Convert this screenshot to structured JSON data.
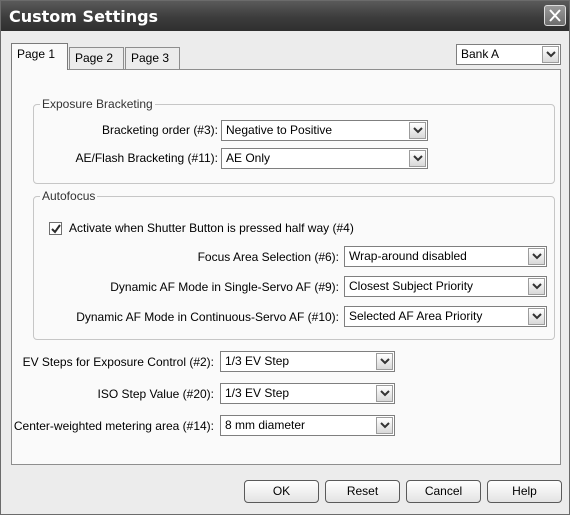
{
  "window": {
    "title": "Custom Settings"
  },
  "tabs": [
    {
      "label": "Page 1",
      "active": true
    },
    {
      "label": "Page 2",
      "active": false
    },
    {
      "label": "Page 3",
      "active": false
    }
  ],
  "bank_select": {
    "value": "Bank A"
  },
  "exposure_bracketing": {
    "legend": "Exposure Bracketing",
    "order_label": "Bracketing order (#3):",
    "order_value": "Negative to Positive",
    "ae_flash_label": "AE/Flash Bracketing (#11):",
    "ae_flash_value": "AE Only"
  },
  "autofocus": {
    "legend": "Autofocus",
    "activate_label": "Activate when Shutter Button is pressed half way (#4)",
    "activate_checked": true,
    "focus_area_label": "Focus Area Selection (#6):",
    "focus_area_value": "Wrap-around disabled",
    "single_servo_label": "Dynamic AF Mode in Single-Servo AF (#9):",
    "single_servo_value": "Closest Subject Priority",
    "continuous_servo_label": "Dynamic AF Mode in Continuous-Servo AF (#10):",
    "continuous_servo_value": "Selected AF Area Priority"
  },
  "other": {
    "ev_steps_label": "EV Steps for Exposure Control (#2):",
    "ev_steps_value": "1/3 EV Step",
    "iso_step_label": "ISO Step Value (#20):",
    "iso_step_value": "1/3 EV Step",
    "center_weighted_label": "Center-weighted metering area (#14):",
    "center_weighted_value": "8 mm diameter"
  },
  "buttons": {
    "ok": "OK",
    "reset": "Reset",
    "cancel": "Cancel",
    "help": "Help"
  },
  "icons": {
    "close": "close-icon",
    "dropdown": "chevron-down-icon",
    "check": "check-icon"
  }
}
